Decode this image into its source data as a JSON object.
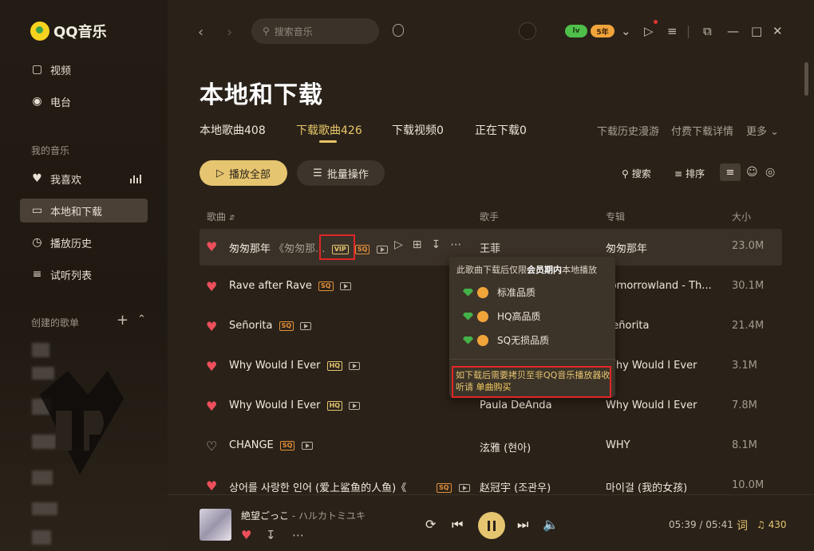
{
  "app": {
    "name": "QQ音乐"
  },
  "sidebar": {
    "items": [
      {
        "label": "视频",
        "icon": "video-icon"
      },
      {
        "label": "电台",
        "icon": "radio-icon"
      }
    ],
    "my_music_title": "我的音乐",
    "my_music": [
      {
        "label": "我喜欢",
        "icon": "heart-icon"
      },
      {
        "label": "本地和下载",
        "icon": "monitor-icon",
        "active": true
      },
      {
        "label": "播放历史",
        "icon": "clock-icon"
      },
      {
        "label": "试听列表",
        "icon": "list-icon"
      }
    ],
    "created_title": "创建的歌单"
  },
  "topbar": {
    "search_placeholder": "搜索音乐",
    "vip_badge_1": "lv",
    "vip_badge_2": "5年"
  },
  "page": {
    "title": "本地和下载",
    "tabs": [
      {
        "label": "本地歌曲408"
      },
      {
        "label": "下载歌曲426",
        "active": true
      },
      {
        "label": "下载视频0"
      },
      {
        "label": "正在下载0"
      }
    ],
    "links": {
      "history": "下载历史漫游",
      "paid": "付费下载详情",
      "more": "更多"
    },
    "play_all": "播放全部",
    "batch": "批量操作",
    "search_tool": "搜索",
    "sort_tool": "排序",
    "columns": {
      "song": "歌曲",
      "artist": "歌手",
      "album": "专辑",
      "size": "大小"
    }
  },
  "songs": [
    {
      "title": "匆匆那年",
      "alt": "《匆匆那...",
      "badge": "VIP",
      "quality": "SQ",
      "artist": "王菲",
      "album": "匆匆那年",
      "size": "23.0M",
      "liked": true
    },
    {
      "title": "Rave after Rave",
      "quality": "SQ",
      "artist": "",
      "album": "Tomorrowland - Th...",
      "size": "30.1M",
      "liked": true
    },
    {
      "title": "Señorita",
      "quality": "SQ",
      "artist": "",
      "album": "Señorita",
      "size": "21.4M",
      "liked": true
    },
    {
      "title": "Why Would I Ever",
      "quality": "HQ",
      "artist": "",
      "album": "Why Would I Ever",
      "size": "3.1M",
      "liked": true
    },
    {
      "title": "Why Would I Ever",
      "quality": "HQ",
      "artist": "Paula DeAnda",
      "album": "Why Would I Ever",
      "size": "7.8M",
      "liked": true
    },
    {
      "title": "CHANGE",
      "quality": "SQ",
      "artist": "泫雅 (현아)",
      "album": "WHY",
      "size": "8.1M",
      "liked": false
    },
    {
      "title": "상어를 사랑한 인어 (爱上鲨鱼的人鱼)《",
      "quality": "SQ",
      "artist": "赵冠宇 (조관우)",
      "album": "마이걸 (我的女孩)",
      "size": "10.0M",
      "liked": true
    }
  ],
  "popup": {
    "title_pre": "此歌曲下载后仅限",
    "title_bold": "会员期内",
    "title_post": "本地播放",
    "options": [
      "标准品质",
      "HQ高品质",
      "SQ无损品质"
    ],
    "note": "如下载后需要拷贝至非QQ音乐播放器收听请",
    "buy": "单曲购买"
  },
  "player": {
    "title": "絶望ごっこ",
    "sep": " - ",
    "artist": "ハルカトミユキ",
    "time": "05:39 / 05:41",
    "lyric": "词",
    "playlist_count": "430"
  },
  "colors": {
    "accent": "#e6c570",
    "heart": "#ec4f5b",
    "highlight_box": "#e02626"
  }
}
